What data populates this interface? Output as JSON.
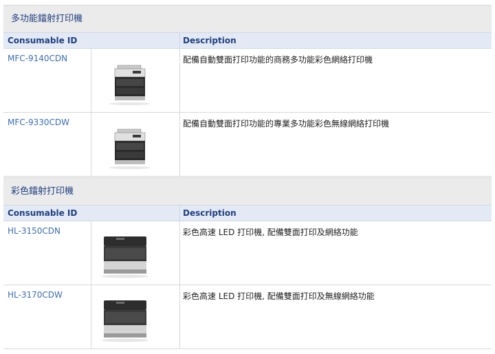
{
  "sections": [
    {
      "title": "多功能鐳射打印機",
      "headers": {
        "id": "Consumable ID",
        "desc": "Description"
      },
      "rows": [
        {
          "id": "MFC-9140CDN",
          "desc": "配備自動雙面打印功能的商務多功能彩色網絡打印機",
          "image": "mfc-printer-icon"
        },
        {
          "id": "MFC-9330CDW",
          "desc": "配備自動雙面打印功能的專業多功能彩色無線網絡打印機",
          "image": "mfc-printer-icon"
        }
      ]
    },
    {
      "title": "彩色鐳射打印機",
      "headers": {
        "id": "Consumable ID",
        "desc": "Description"
      },
      "rows": [
        {
          "id": "HL-3150CDN",
          "desc": "彩色高速 LED 打印機, 配備雙面打印及網絡功能",
          "image": "laser-printer-icon"
        },
        {
          "id": "HL-3170CDW",
          "desc": "彩色高速 LED 打印機, 配備雙面打印及無線網絡功能",
          "image": "laser-printer-icon"
        }
      ]
    }
  ]
}
